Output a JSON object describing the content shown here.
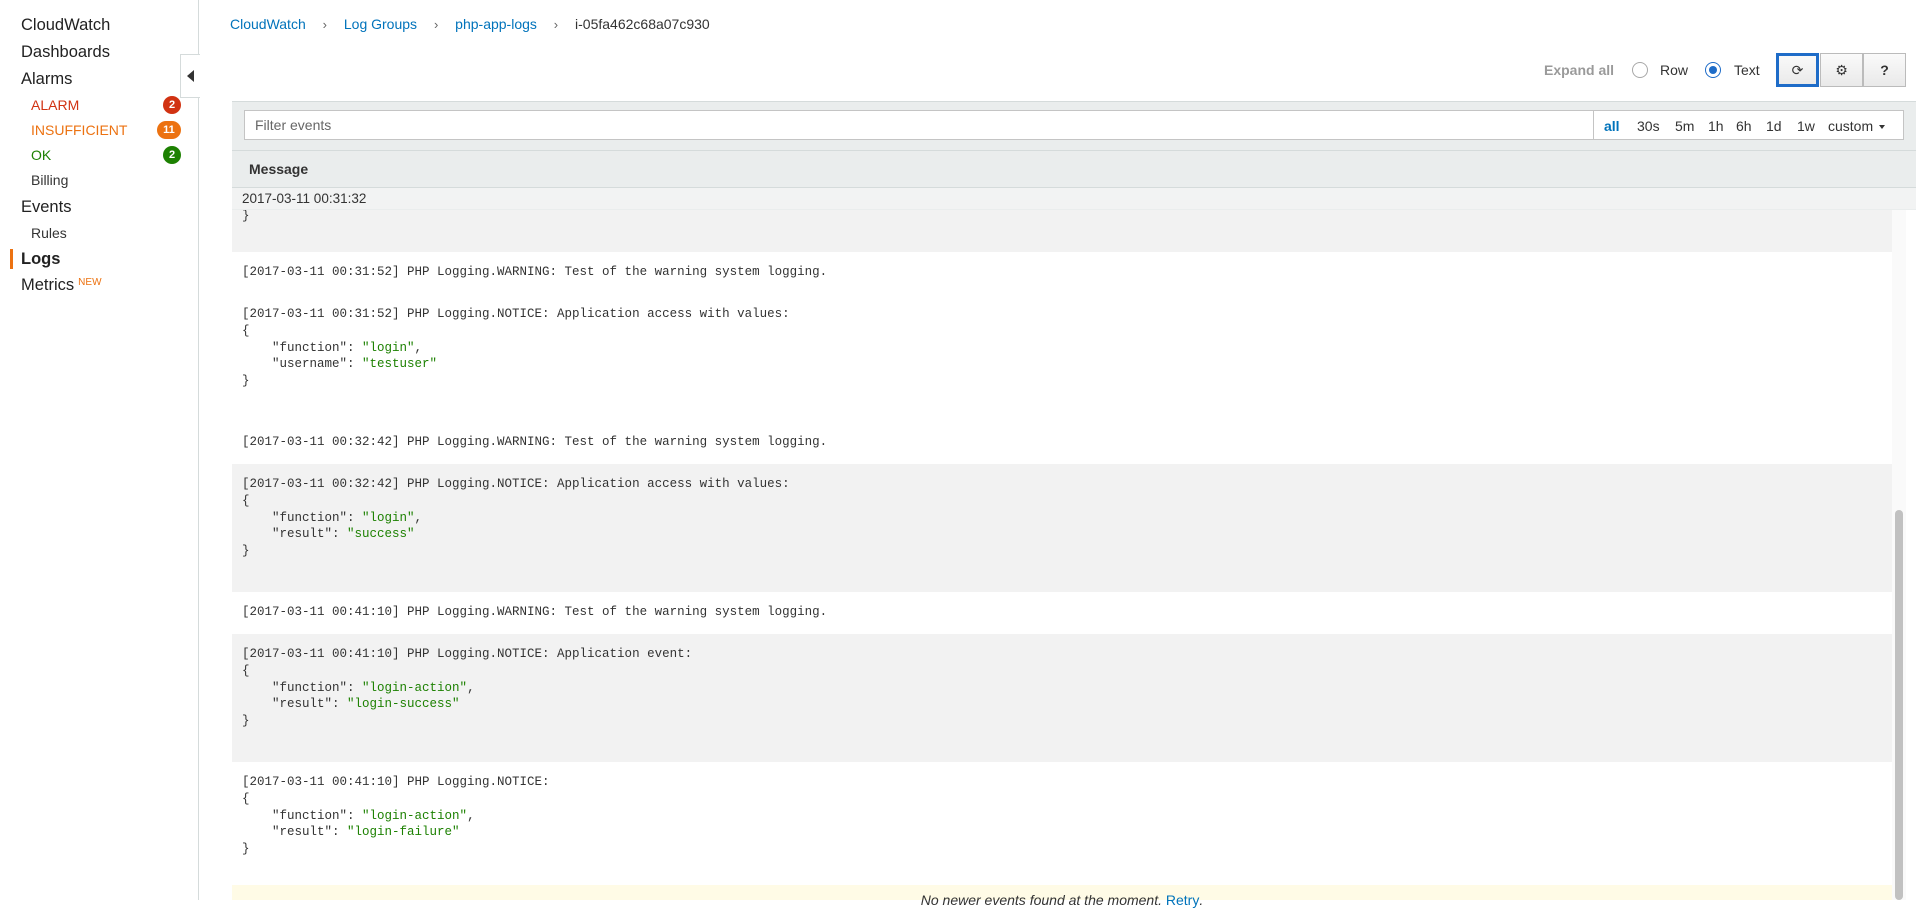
{
  "sidebar": {
    "items": [
      {
        "label": "CloudWatch"
      },
      {
        "label": "Dashboards"
      },
      {
        "label": "Alarms"
      }
    ],
    "alarms": [
      {
        "label": "ALARM",
        "count": "2",
        "color": "#d13212"
      },
      {
        "label": "INSUFFICIENT",
        "count": "11",
        "color": "#ec7211"
      },
      {
        "label": "OK",
        "count": "2",
        "color": "#1d8102"
      }
    ],
    "billing": "Billing",
    "events": "Events",
    "rules": "Rules",
    "logs": "Logs",
    "metrics": "Metrics",
    "metrics_tag": "NEW",
    "accent_color": "#ec7211"
  },
  "breadcrumb": {
    "items": [
      "CloudWatch",
      "Log Groups",
      "php-app-logs"
    ],
    "current": "i-05fa462c68a07c930",
    "separator": "›"
  },
  "toolbar": {
    "expand_all": "Expand all",
    "view_options": [
      {
        "label": "Row",
        "selected": false
      },
      {
        "label": "Text",
        "selected": true
      }
    ],
    "buttons": [
      {
        "name": "refresh-icon",
        "glyph": "⟳"
      },
      {
        "name": "gear-icon",
        "glyph": "⚙"
      },
      {
        "name": "help-icon",
        "glyph": "?"
      }
    ]
  },
  "filter": {
    "placeholder": "Filter events",
    "value": "",
    "time_ranges": [
      "all",
      "30s",
      "5m",
      "1h",
      "6h",
      "1d",
      "1w",
      "custom"
    ],
    "selected": "all"
  },
  "log_table": {
    "header": "Message",
    "sticky_timestamp": "2017-03-11 00:31:32"
  },
  "events": [
    {
      "shaded": true,
      "lines": [
        {
          "text": "}"
        }
      ]
    },
    {
      "shaded": false,
      "lines": [
        {
          "text": "[2017-03-11 00:31:52] PHP Logging.WARNING: Test of the warning system logging."
        }
      ]
    },
    {
      "shaded": false,
      "lines": [
        {
          "text": "[2017-03-11 00:31:52] PHP Logging.NOTICE: Application access with values:"
        },
        {
          "text": "{"
        },
        {
          "key": "    \"function\": ",
          "val": "\"login\"",
          "tail": ","
        },
        {
          "key": "    \"username\": ",
          "val": "\"testuser\"",
          "tail": ""
        },
        {
          "text": "}"
        }
      ]
    },
    {
      "shaded": false,
      "lines": [
        {
          "text": "[2017-03-11 00:32:42] PHP Logging.WARNING: Test of the warning system logging."
        }
      ]
    },
    {
      "shaded": true,
      "lines": [
        {
          "text": "[2017-03-11 00:32:42] PHP Logging.NOTICE: Application access with values:"
        },
        {
          "text": "{"
        },
        {
          "key": "    \"function\": ",
          "val": "\"login\"",
          "tail": ","
        },
        {
          "key": "    \"result\": ",
          "val": "\"success\"",
          "tail": ""
        },
        {
          "text": "}"
        }
      ]
    },
    {
      "shaded": false,
      "lines": [
        {
          "text": "[2017-03-11 00:41:10] PHP Logging.WARNING: Test of the warning system logging."
        }
      ]
    },
    {
      "shaded": true,
      "lines": [
        {
          "text": "[2017-03-11 00:41:10] PHP Logging.NOTICE: Application event:"
        },
        {
          "text": "{"
        },
        {
          "key": "    \"function\": ",
          "val": "\"login-action\"",
          "tail": ","
        },
        {
          "key": "    \"result\": ",
          "val": "\"login-success\"",
          "tail": ""
        },
        {
          "text": "}"
        }
      ]
    },
    {
      "shaded": false,
      "lines": [
        {
          "text": "[2017-03-11 00:41:10] PHP Logging.NOTICE:"
        },
        {
          "text": "{"
        },
        {
          "key": "    \"function\": ",
          "val": "\"login-action\"",
          "tail": ","
        },
        {
          "key": "    \"result\": ",
          "val": "\"login-failure\"",
          "tail": ""
        },
        {
          "text": "}"
        }
      ]
    }
  ],
  "footer": {
    "message": "No newer events found at the moment.",
    "retry": "Retry"
  }
}
